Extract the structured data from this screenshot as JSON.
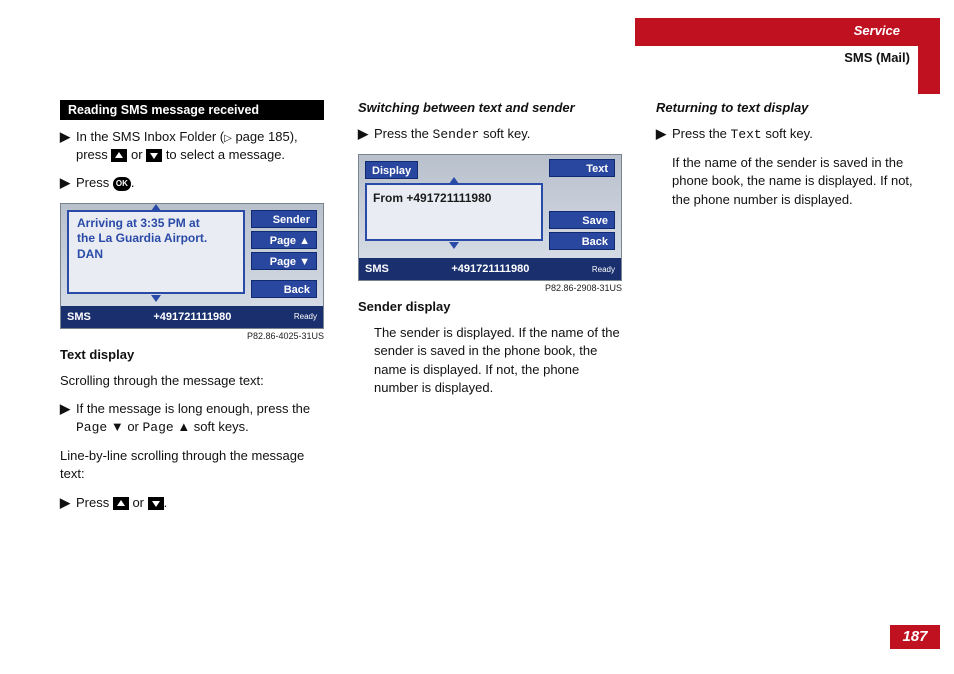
{
  "header": {
    "service": "Service",
    "section": "SMS (Mail)",
    "page_number": "187"
  },
  "col1": {
    "black_bar": "Reading SMS message received",
    "step1_pre": "In the SMS Inbox Folder (",
    "step1_ref": "page 185",
    "step1_mid": "), press ",
    "step1_post": " to select a message.",
    "or": " or ",
    "step2_pre": "Press ",
    "step2_post": ".",
    "ok": "OK",
    "fig": {
      "msg_line1": "Arriving at 3:35 PM at",
      "msg_line2": "the La Guardia Airport.",
      "msg_line3": "DAN",
      "sk_sender": "Sender",
      "sk_pageup": "Page ▲",
      "sk_pagedown": "Page ▼",
      "sk_back": "Back",
      "status_left": "SMS",
      "status_center": "+491721111980",
      "status_right": "Ready",
      "id": "P82.86-4025-31US"
    },
    "h_text_display": "Text display",
    "scroll_para": "Scrolling through the message text:",
    "step3_pre": "If the message is long enough, press the ",
    "page_lbl": "Page",
    "page_down_sym": " ▼ ",
    "page_up_sym": " ▲ ",
    "soft_keys_sfx": "soft keys.",
    "line_para": "Line-by-line scrolling through the message text:"
  },
  "col2": {
    "heading": "Switching between text and sender",
    "step1_pre": "Press the ",
    "sender_key": "Sender",
    "step1_post": " soft key.",
    "fig": {
      "display": "Display",
      "from": "From  +491721111980",
      "sk_text": "Text",
      "sk_save": "Save",
      "sk_back": "Back",
      "status_left": "SMS",
      "status_center": "+491721111980",
      "status_right": "Ready",
      "id": "P82.86-2908-31US"
    },
    "h_sender_display": "Sender display",
    "para": "The sender is displayed. If the name of the sender is saved in the phone book, the name is displayed. If not, the phone number is displayed."
  },
  "col3": {
    "heading": "Returning to text display",
    "step1_pre": "Press the ",
    "text_key": "Text",
    "step1_post": " soft key.",
    "para": "If the name of the sender is saved in the phone book, the name is displayed. If not, the phone number is displayed."
  }
}
